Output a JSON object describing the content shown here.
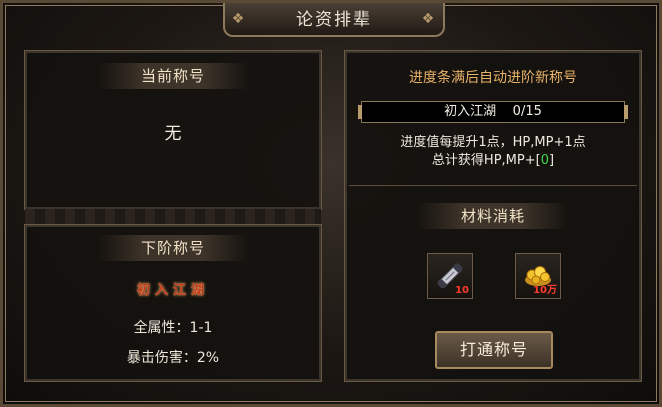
{
  "window": {
    "title": "论资排辈"
  },
  "current": {
    "header": "当前称号",
    "value": "无"
  },
  "next": {
    "header": "下阶称号",
    "title_name": "初入江湖",
    "attrs": [
      "全属性：1-1",
      "暴击伤害：2%"
    ]
  },
  "advance": {
    "header_text": "进度条满后自动进阶新称号",
    "progress": {
      "name": "初入江湖",
      "current": 0,
      "max": 15,
      "text": "0/15"
    },
    "line1": "进度值每提升1点，HP,MP+1点",
    "line2_prefix": "总计获得HP,MP+",
    "line2_open": "[",
    "line2_value": "0",
    "line2_close": "]"
  },
  "materials": {
    "header": "材料消耗",
    "items": [
      {
        "icon": "scroll-item-icon",
        "qty": "10"
      },
      {
        "icon": "gold-ingot-icon",
        "qty": "10万"
      }
    ]
  },
  "action": {
    "label": "打通称号"
  },
  "colors": {
    "accent_gold": "#e8b26a",
    "bonus_green": "#43d64a",
    "qty_red": "#ff3c2e",
    "badge_red": "#c23b1d"
  }
}
